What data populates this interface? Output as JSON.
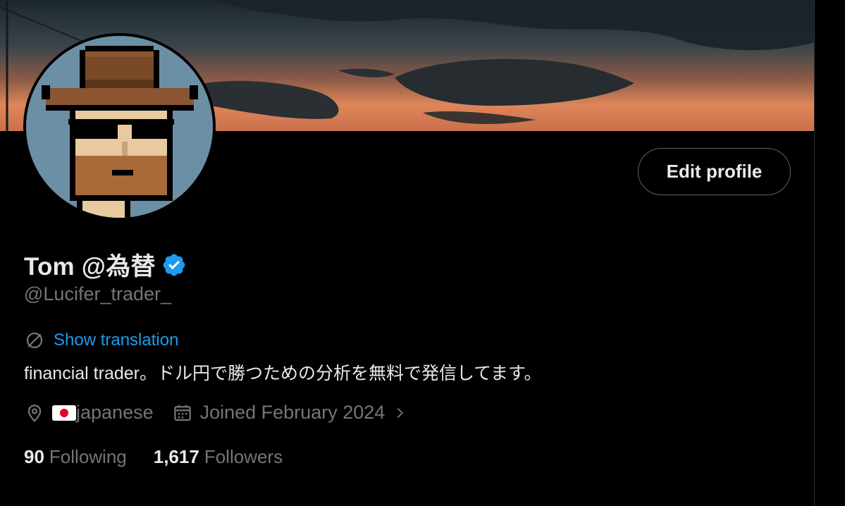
{
  "profile": {
    "display_name": "Tom @為替",
    "handle": "@Lucifer_trader_",
    "edit_profile_label": "Edit profile",
    "translate_label": "Show translation",
    "bio": "financial trader。ドル円で勝つための分析を無料で発信してます。",
    "location": "japanese",
    "joined": "Joined February 2024",
    "following_count": "90",
    "following_label": "Following",
    "followers_count": "1,617",
    "followers_label": "Followers"
  },
  "icons": {
    "verified": "verified-badge-icon",
    "translate": "translate-icon",
    "location": "location-pin-icon",
    "flag": "japan-flag-icon",
    "calendar": "calendar-icon",
    "chevron": "chevron-right-icon"
  },
  "colors": {
    "background": "#000000",
    "text_primary": "#e7e9ea",
    "text_secondary": "#71767b",
    "accent": "#1d9bf0",
    "border": "#536471"
  }
}
